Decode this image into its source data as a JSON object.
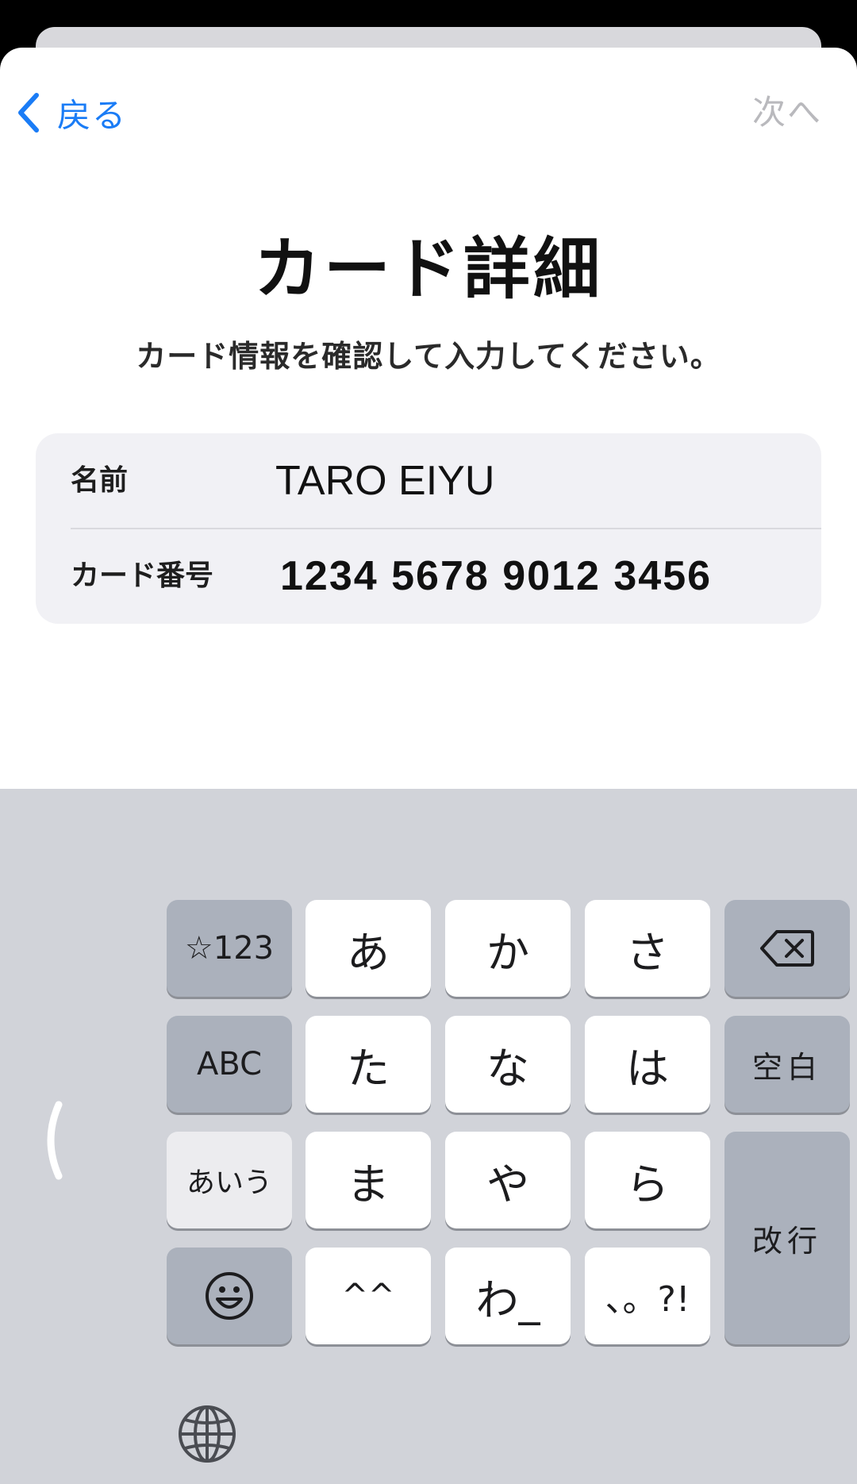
{
  "nav": {
    "back_label": "戻る",
    "next_label": "次へ"
  },
  "header": {
    "title": "カード詳細",
    "subtitle": "カード情報を確認して入力してください。"
  },
  "form": {
    "name_label": "名前",
    "name_value": "TARO EIYU",
    "card_number_label": "カード番号",
    "card_number_value": "1234 5678 9012 3456"
  },
  "keyboard": {
    "mode_keys": {
      "symbols": "☆123",
      "abc": "ABC",
      "kana": "あいう"
    },
    "kana_keys": [
      "あ",
      "か",
      "さ",
      "た",
      "な",
      "は",
      "ま",
      "や",
      "ら",
      "^^",
      "わ_",
      "、。?!"
    ],
    "space_label": "空白",
    "return_label": "改行",
    "icons": {
      "delete": "backspace-icon",
      "emoji": "emoji-smile-icon",
      "globe": "globe-icon",
      "prev": "chevron-left-icon"
    }
  },
  "colors": {
    "accent": "#1a7cf6",
    "disabled": "#b9b9bd",
    "keyboard_bg": "#d1d3d9",
    "func_key": "#abb1bc"
  }
}
